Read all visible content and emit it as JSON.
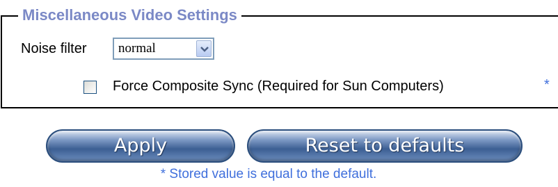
{
  "section": {
    "title": "Miscellaneous Video Settings"
  },
  "noise_filter": {
    "label": "Noise filter",
    "selected": "normal"
  },
  "composite_sync": {
    "label": "Force Composite Sync (Required for Sun Computers)",
    "marker": "*",
    "checked": false
  },
  "buttons": {
    "apply_label": "Apply",
    "reset_label": "Reset to defaults"
  },
  "footnote": "* Stored value is equal to the default.",
  "colors": {
    "legend": "#7b89c6",
    "accent": "#3f6fdc",
    "button": "#3c5f93"
  },
  "icons": {
    "dropdown": "chevron-down-icon"
  }
}
